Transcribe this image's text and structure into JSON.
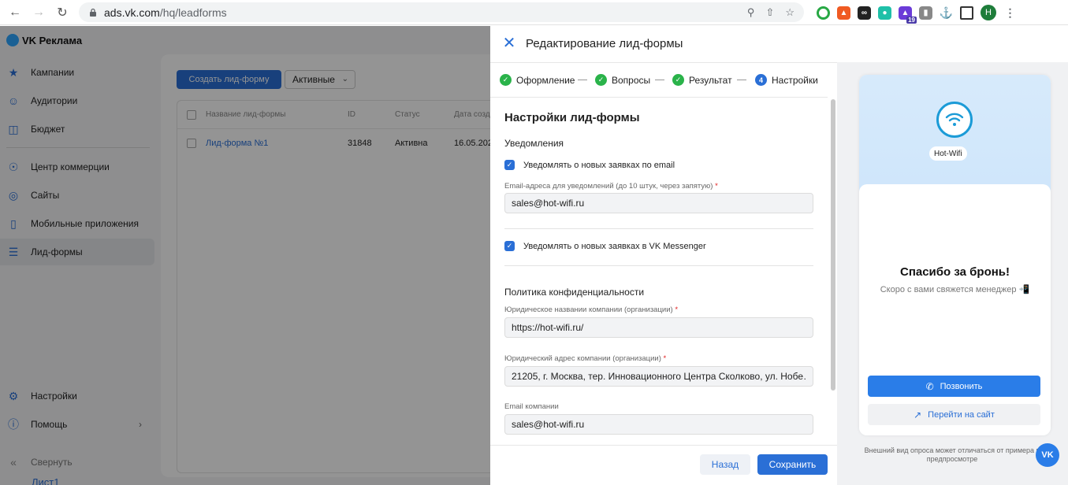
{
  "browser": {
    "url_host": "ads.vk.com",
    "url_path": "/hq/leadforms",
    "avatar_letter": "H",
    "ext_badge": "19"
  },
  "app": {
    "logo": "VK Реклама",
    "sidebar": [
      {
        "label": "Кампании",
        "icon": "megaphone-icon"
      },
      {
        "label": "Аудитории",
        "icon": "users-icon"
      },
      {
        "label": "Бюджет",
        "icon": "wallet-icon"
      },
      {
        "label": "Центр коммерции",
        "icon": "cart-icon"
      },
      {
        "label": "Сайты",
        "icon": "globe-icon"
      },
      {
        "label": "Мобильные приложения",
        "icon": "phone-icon"
      },
      {
        "label": "Лид-формы",
        "icon": "list-icon"
      },
      {
        "label": "Настройки",
        "icon": "gear-icon"
      },
      {
        "label": "Помощь",
        "icon": "help-icon"
      },
      {
        "label": "Свернуть",
        "icon": "collapse-icon"
      }
    ],
    "create_button": "Создать лид-форму",
    "filter_value": "Активные",
    "table": {
      "headers": [
        "Название лид-формы",
        "ID",
        "Статус",
        "Дата созд"
      ],
      "rows": [
        [
          "Лид-форма №1",
          "31848",
          "Активна",
          "16.05.202"
        ]
      ]
    },
    "bottom_tab": "Лист1"
  },
  "modal": {
    "title": "Редактирование лид-формы",
    "steps": [
      {
        "label": "Оформление",
        "state": "done"
      },
      {
        "label": "Вопросы",
        "state": "done"
      },
      {
        "label": "Результат",
        "state": "done"
      },
      {
        "label": "Настройки",
        "state": "current",
        "number": "4"
      }
    ],
    "section_title": "Настройки лид-формы",
    "notifications_heading": "Уведомления",
    "notify_email_label": "Уведомлять о новых заявках по email",
    "emails_label": "Email-адреса для уведомлений (до 10 штук, через запятую)",
    "emails_value": "sales@hot-wifi.ru",
    "notify_vk_label": "Уведомлять о новых заявках в VK Messenger",
    "privacy_heading": "Политика конфиденциальности",
    "company_name_label": "Юридическое названии компании (организации)",
    "company_name_value": "https://hot-wifi.ru/",
    "company_address_label": "Юридический адрес компании (организации)",
    "company_address_value": "21205, г. Москва, тер. Инновационного Центра Сколково, ул. Нобе…",
    "company_email_label": "Email компании",
    "company_email_value": "sales@hot-wifi.ru",
    "back_button": "Назад",
    "save_button": "Сохранить"
  },
  "preview": {
    "brand_name": "Hot-Wifi",
    "thanks_title": "Спасибо за бронь!",
    "thanks_text": "Скоро с вами свяжется менеджер 📲",
    "call_button": "Позвонить",
    "site_button": "Перейти на сайт",
    "disclaimer": "Внешний вид опроса может отличаться от примера в предпросмотре",
    "fab_label": "VK"
  },
  "colors": {
    "accent": "#2a6fd6",
    "success": "#2ab34a",
    "required": "#e02020"
  }
}
